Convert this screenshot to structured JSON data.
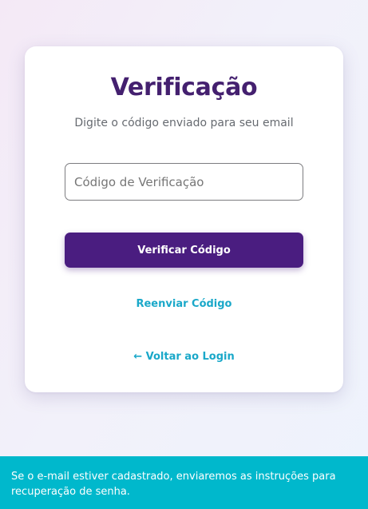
{
  "verification": {
    "title": "Verificação",
    "subtitle": "Digite o código enviado para seu email",
    "code_placeholder": "Código de Verificação",
    "verify_button": "Verificar Código",
    "resend_link": "Reenviar Código",
    "back_link": "← Voltar ao Login"
  },
  "toast": {
    "message": "Se o e-mail estiver cadastrado, enviaremos as instruções para recuperação de senha."
  },
  "colors": {
    "primary": "#4a1d80",
    "title": "#44206f",
    "link": "#1aa8c9",
    "toast": "#00b8cc"
  }
}
